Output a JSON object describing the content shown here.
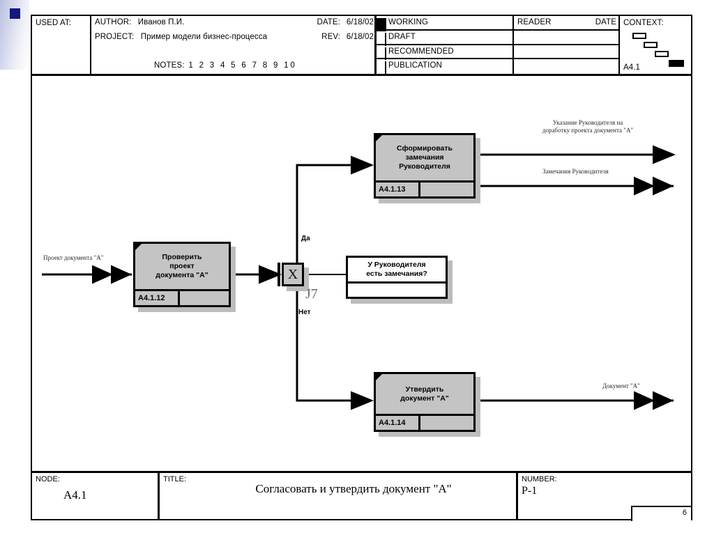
{
  "header": {
    "used_at_label": "USED AT:",
    "author_label": "AUTHOR:",
    "author_value": "Иванов П.И.",
    "project_label": "PROJECT:",
    "project_value": "Пример модели бизнес-процесса",
    "date_label": "DATE:",
    "date_value": "6/18/02",
    "rev_label": "REV:",
    "rev_value": "6/18/02",
    "notes_label": "NOTES:",
    "notes_numbers": "1 2 3 4 5 6 7 8 9 10",
    "status_rows": [
      {
        "label": "WORKING",
        "checked": true
      },
      {
        "label": "DRAFT",
        "checked": false
      },
      {
        "label": "RECOMMENDED",
        "checked": false
      },
      {
        "label": "PUBLICATION",
        "checked": false
      }
    ],
    "reader_label": "READER",
    "reader_date_label": "DATE",
    "context_label": "CONTEXT:",
    "context_node": "A4.1"
  },
  "diagram": {
    "activities": [
      {
        "id": "A4.1.13",
        "title_lines": [
          "Сформировать",
          "замечания",
          "Руководителя"
        ],
        "title": "Сформировать замечания Руководителя"
      },
      {
        "id": "A4.1.12",
        "title_lines": [
          "Проверить",
          "проект",
          "документа \"А\""
        ],
        "title": "Проверить проект документа \"А\""
      },
      {
        "id": "A4.1.14",
        "title_lines": [
          "Утвердить",
          "документ \"А\""
        ],
        "title": "Утвердить документ \"А\""
      }
    ],
    "note_box": {
      "line1": "У Руководителя",
      "line2": "есть замечания?"
    },
    "junction": {
      "symbol": "X",
      "label": "J7",
      "type": "XOR"
    },
    "branch_labels": {
      "yes": "Да",
      "no": "Нет"
    },
    "flows": {
      "input": "Проект документа \"А\"",
      "out_rework_line1": "Указание Руководителя на",
      "out_rework_line2": "доработку проекта документа \"А\"",
      "out_remarks": "Замечания Руководителя",
      "out_document": "Документ \"А\""
    }
  },
  "footer": {
    "node_label": "NODE:",
    "node_value": "A4.1",
    "title_label": "TITLE:",
    "title_value": "Согласовать и утвердить документ \"А\"",
    "number_label": "NUMBER:",
    "number_value": "P-1",
    "page": "6"
  },
  "colors": {
    "box_fill": "#c4c4c4",
    "shadow": "#bdbdbd",
    "line": "#000000",
    "accent_bullet": "#14177f"
  }
}
